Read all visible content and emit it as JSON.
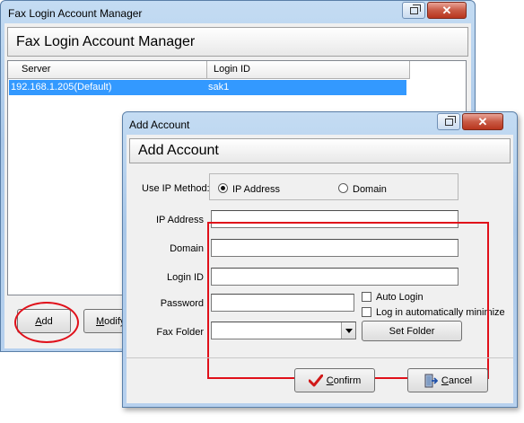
{
  "main_window": {
    "title": "Fax Login Account Manager",
    "header": "Fax Login Account Manager",
    "columns": [
      "Server",
      "Login ID"
    ],
    "rows": [
      {
        "server": "192.168.1.205(Default)",
        "login_id": "sak1"
      }
    ],
    "buttons": {
      "add": "Add",
      "modify": "Modify"
    }
  },
  "dialog": {
    "title": "Add Account",
    "header": "Add Account",
    "ip_method_label": "Use IP Method:",
    "ip_method_options": [
      "IP Address",
      "Domain"
    ],
    "ip_method_selected": "IP Address",
    "fields": {
      "ip_address": {
        "label": "IP Address",
        "value": ""
      },
      "domain": {
        "label": "Domain",
        "value": ""
      },
      "login_id": {
        "label": "Login ID",
        "value": ""
      },
      "password": {
        "label": "Password",
        "value": ""
      },
      "fax_folder": {
        "label": "Fax Folder",
        "value": ""
      }
    },
    "checkboxes": {
      "auto_login": {
        "label": "Auto Login",
        "checked": false
      },
      "auto_minimize": {
        "label": "Log in automatically minimize",
        "checked": false
      }
    },
    "buttons": {
      "set_folder": "Set Folder",
      "confirm": "Confirm",
      "cancel": "Cancel"
    }
  },
  "icons": [
    "restore-icon",
    "close-icon",
    "checkmark-icon",
    "exit-door-icon",
    "dropdown-arrow-icon"
  ],
  "colors": {
    "selection": "#3399ff",
    "annotation": "#e0101a",
    "close_button": "#c95a45"
  }
}
